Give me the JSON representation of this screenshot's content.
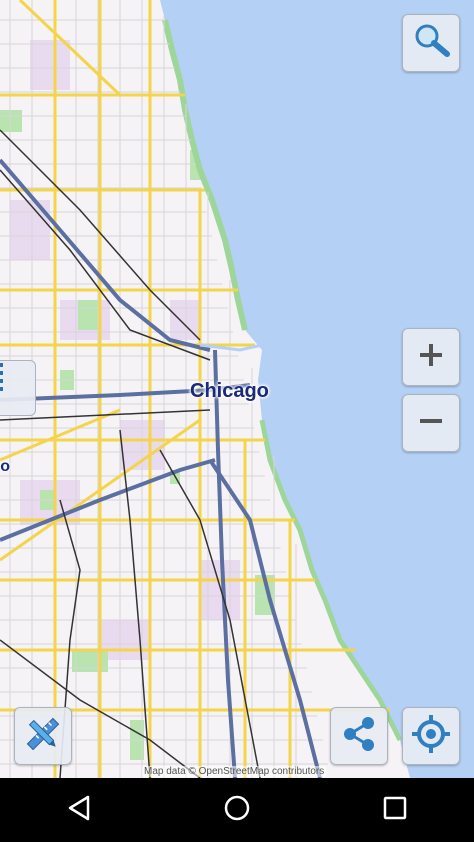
{
  "map": {
    "city_label": "Chicago",
    "partial_label": "ro",
    "attribution": "Map data © OpenStreetMap contributors",
    "colors": {
      "water": "#b5d0f5",
      "land": "#f6f3f6",
      "major_road": "#f3d44a",
      "expressway": "#5b6fa0",
      "park": "#b9e4b0",
      "rail": "#333333",
      "residential": "#e6d4ee"
    }
  },
  "controls": {
    "search": {
      "icon": "magnifier-icon"
    },
    "zoom_in": {
      "icon": "plus-icon"
    },
    "zoom_out": {
      "icon": "minus-icon"
    },
    "layers": {
      "icon": "list-icon"
    },
    "tools": {
      "icon": "ruler-pencil-icon"
    },
    "share": {
      "icon": "share-icon"
    },
    "locate": {
      "icon": "crosshair-icon"
    }
  },
  "navbar": {
    "back": {
      "icon": "back-triangle-icon"
    },
    "home": {
      "icon": "home-circle-icon"
    },
    "recents": {
      "icon": "recents-square-icon"
    }
  }
}
